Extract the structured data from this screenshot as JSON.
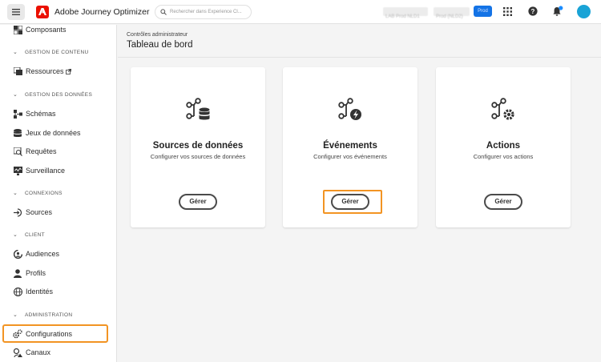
{
  "topbar": {
    "app_title": "Adobe Journey Optimizer",
    "search_placeholder": "Rechercher dans Experience Cl...",
    "org_chip_1": "LAB Prod NLD1",
    "org_chip_2": "Prod (NLD2)",
    "env_button": "Prod",
    "icons": [
      "menu-icon",
      "adobe-logo-icon",
      "search-icon",
      "apps-grid-icon",
      "help-icon",
      "bell-icon"
    ]
  },
  "sidebar": {
    "items": {
      "composants": "Composants",
      "content_header": "GESTION DE CONTENU",
      "ressources": "Ressources",
      "data_header": "GESTION DES DONNÉES",
      "schemas": "Schémas",
      "datasets": "Jeux de données",
      "queries": "Requêtes",
      "monitoring": "Surveillance",
      "connections_header": "CONNEXIONS",
      "sources": "Sources",
      "client_header": "CLIENT",
      "audiences": "Audiences",
      "profiles": "Profils",
      "identities": "Identités",
      "admin_header": "ADMINISTRATION",
      "configurations": "Configurations",
      "channels": "Canaux"
    },
    "selected": "configurations"
  },
  "main": {
    "breadcrumb": "Contrôles administrateur",
    "title": "Tableau de bord",
    "cards": [
      {
        "title": "Sources de données",
        "subtitle": "Configurer vos sources de données",
        "button": "Gérer",
        "icon": "data-sources-icon"
      },
      {
        "title": "Événements",
        "subtitle": "Configurer vos événements",
        "button": "Gérer",
        "icon": "events-icon",
        "highlighted": true
      },
      {
        "title": "Actions",
        "subtitle": "Configurer vos actions",
        "button": "Gérer",
        "icon": "actions-icon"
      }
    ]
  },
  "colors": {
    "accent_highlight": "#f29423",
    "adobe_red": "#eb1000",
    "blue": "#1473e6"
  }
}
